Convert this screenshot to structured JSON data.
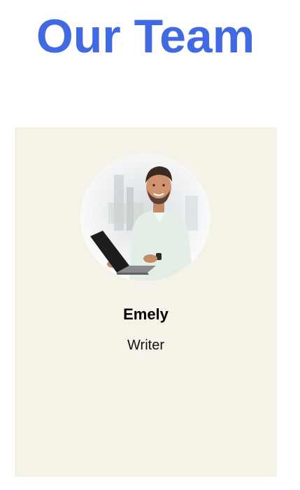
{
  "page": {
    "title": "Our Team",
    "title_color": "#4169e1",
    "background_color": "#ffffff"
  },
  "team_card": {
    "background_color": "#f5f2e7",
    "member": {
      "name": "Emely",
      "role": "Writer",
      "photo": "man-with-laptop-photo"
    }
  }
}
